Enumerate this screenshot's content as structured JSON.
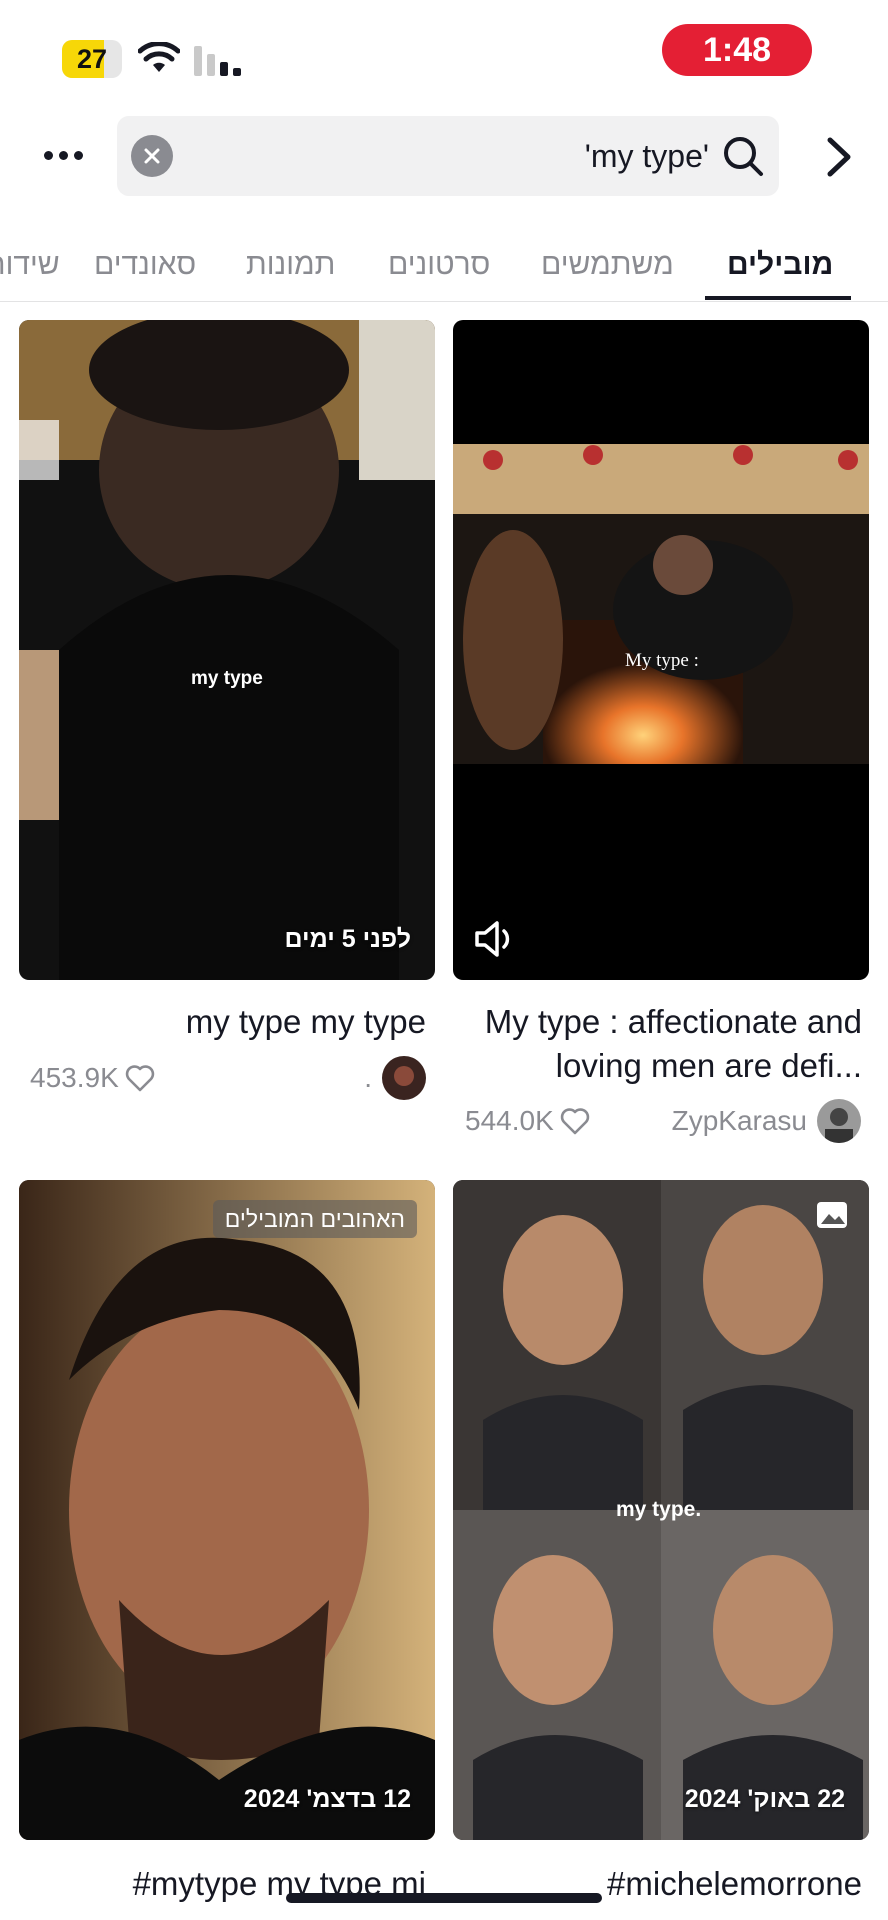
{
  "status_bar": {
    "battery": "27",
    "time": "1:48",
    "time_bg": "#e41f34",
    "battery_color": "#f7d708"
  },
  "search": {
    "query": "'my type'",
    "clear_icon": "clear-icon",
    "search_icon": "search-icon"
  },
  "nav": {
    "more_icon": "more-icon",
    "back_icon": "chevron-right-icon"
  },
  "tabs": [
    {
      "label": "מובילים",
      "active": true
    },
    {
      "label": "משתמשים",
      "active": false
    },
    {
      "label": "סרטונים",
      "active": false
    },
    {
      "label": "תמונות",
      "active": false
    },
    {
      "label": "סאונדים",
      "active": false
    },
    {
      "label": "שידורים",
      "active": false
    }
  ],
  "cards": [
    {
      "title": "My type : affectionate and loving men are defi...",
      "likes": "544.0K",
      "author": "ZypKarasu",
      "overlay_text": "My type :"
    },
    {
      "title": "my type my type",
      "likes": "453.9K",
      "author": ".",
      "overlay_text": "my type",
      "date": "לפני 5 ימים"
    },
    {
      "title": "#michelemorrone",
      "overlay_text": "my type.",
      "date": "22 באוק' 2024"
    },
    {
      "title": "#mytype my type mi",
      "badge": "האהובים המובילים",
      "date": "12 בדצמ' 2024"
    }
  ],
  "colors": {
    "accent": "#161823",
    "muted": "#8a8b91"
  }
}
